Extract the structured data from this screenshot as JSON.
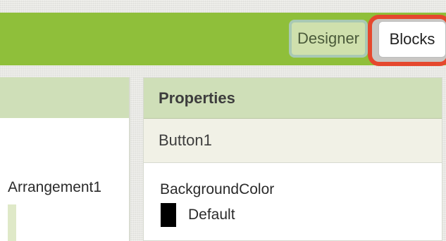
{
  "toolbar": {
    "designer_label": "Designer",
    "blocks_label": "Blocks"
  },
  "components_tree": {
    "partial_item_label": "Arrangement1"
  },
  "properties": {
    "header": "Properties",
    "component_name": "Button1",
    "background_color": {
      "label": "BackgroundColor",
      "value": "Default",
      "swatch_color": "#000000"
    }
  },
  "colors": {
    "top_bar": "#8fbf3a",
    "panel_header": "#cfdfb8",
    "highlight": "#e5482e"
  }
}
